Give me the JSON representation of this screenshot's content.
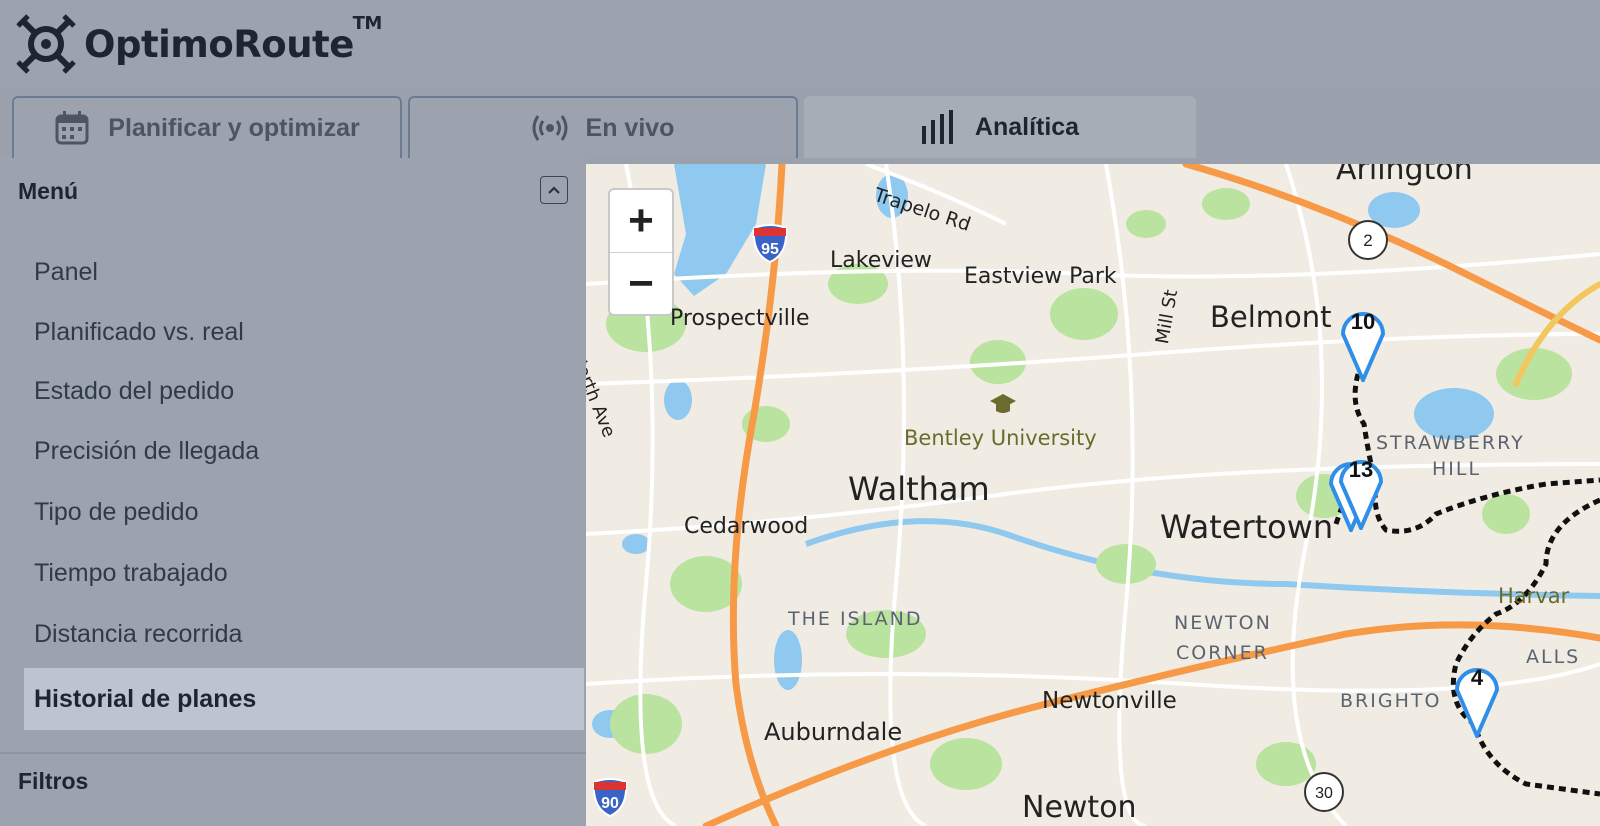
{
  "app": {
    "logo_text": "OptimoRoute",
    "logo_tm": "TM"
  },
  "tabs": [
    {
      "label": "Planificar y optimizar",
      "icon": "calendar-icon"
    },
    {
      "label": "En vivo",
      "icon": "broadcast-icon"
    },
    {
      "label": "Analítica",
      "icon": "bar-chart-icon",
      "active": true
    }
  ],
  "sidebar": {
    "menu_title": "Menú",
    "items": [
      {
        "label": "Panel"
      },
      {
        "label": "Planificado vs. real"
      },
      {
        "label": "Estado del pedido"
      },
      {
        "label": "Precisión de llegada"
      },
      {
        "label": "Tipo de pedido"
      },
      {
        "label": "Tiempo trabajado"
      },
      {
        "label": "Distancia recorrida"
      },
      {
        "label": "Historial de planes",
        "selected": true
      }
    ],
    "filters_title": "Filtros"
  },
  "map": {
    "zoom_in": "+",
    "zoom_out": "−",
    "places": {
      "arlington": "Arlington",
      "trapelo": "Trapelo Rd",
      "lakeview": "Lakeview",
      "eastview": "Eastview Park",
      "millst": "Mill St",
      "belmont": "Belmont",
      "prospectville": "Prospectville",
      "northave": "North Ave",
      "bentley": "Bentley University",
      "strawberry1": "STRAWBERRY",
      "strawberry2": "HILL",
      "waltham": "Waltham",
      "watertown": "Watertown",
      "cedarwood": "Cedarwood",
      "harvard": "Harvar",
      "theisland": "THE ISLAND",
      "newton1": "NEWTON",
      "newton2": "CORNER",
      "allston": "ALLS",
      "brighton": "BRIGHTO",
      "newtonville": "Newtonville",
      "auburndale": "Auburndale",
      "newton": "Newton"
    },
    "shields": {
      "i95": "95",
      "i90": "90",
      "r2": "2",
      "r30": "30"
    },
    "markers": {
      "m10": "10",
      "m13": "13",
      "m4": "4"
    },
    "colors": {
      "route_orange": "#f79a48",
      "water": "#8fc9ef",
      "park": "#b9e39f",
      "marker": "#2f8ee8"
    }
  }
}
